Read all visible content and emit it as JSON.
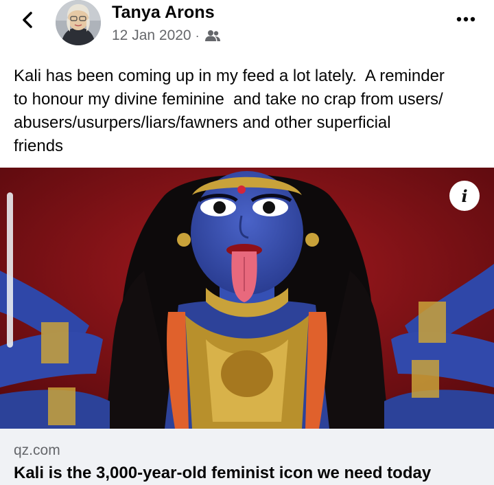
{
  "post": {
    "author": "Tanya Arons",
    "date": "12 Jan 2020",
    "separator": "·",
    "audience_icon": "friends-icon",
    "text": "Kali has been coming up in my feed a lot lately.  A reminder\nto honour my divine feminine  and take no crap from users/\nabusers/usurpers/liars/fawners and other superficial\nfriends"
  },
  "header": {
    "back_icon": "chevron-left-icon",
    "more_icon": "more-horizontal-icon"
  },
  "media": {
    "info_label": "i"
  },
  "link": {
    "domain": "qz.com",
    "title": "Kali is the 3,000-year-old feminist icon we need today"
  },
  "colors": {
    "text": "#050505",
    "secondary": "#65676b",
    "card_bg": "#f0f2f5"
  }
}
